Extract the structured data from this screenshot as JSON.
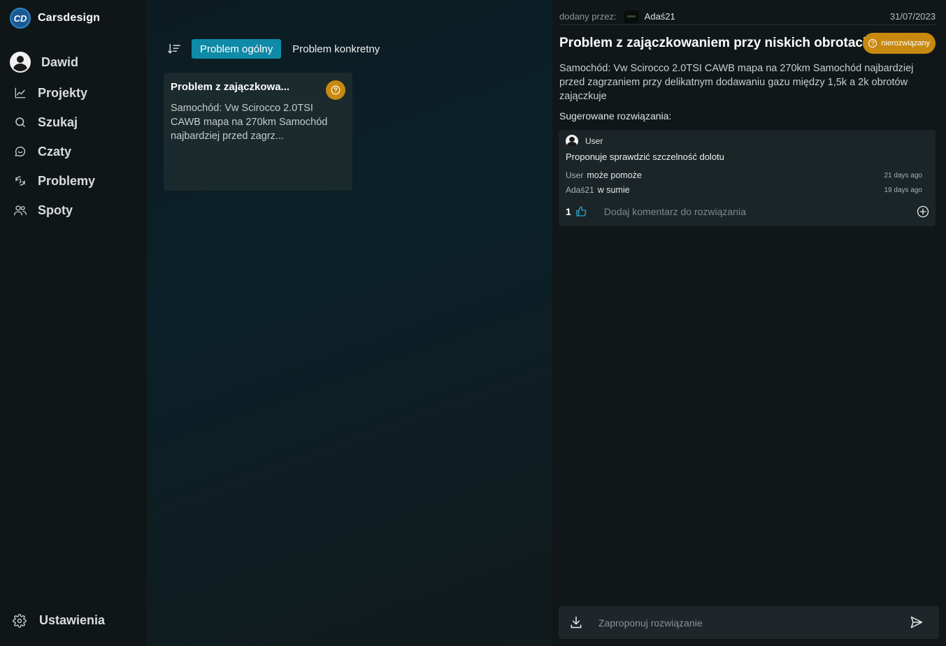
{
  "brand": {
    "logo_text": "CD",
    "name": "Carsdesign"
  },
  "sidebar": {
    "user_name": "Dawid",
    "items": [
      {
        "label": "Projekty",
        "icon": "chart-line-icon"
      },
      {
        "label": "Szukaj",
        "icon": "search-icon"
      },
      {
        "label": "Czaty",
        "icon": "chat-icon"
      },
      {
        "label": "Problemy",
        "icon": "problems-icon"
      },
      {
        "label": "Spoty",
        "icon": "users-icon"
      }
    ],
    "settings_label": "Ustawienia"
  },
  "filters": {
    "active": "Problem ogólny",
    "inactive": "Problem konkretny"
  },
  "problem_card": {
    "title": "Problem z zajączkowa...",
    "excerpt": "Samochód: Vw Scirocco 2.0TSI CAWB mapa na 270km Samochód najbardziej przed zagrz..."
  },
  "detail": {
    "added_by_label": "dodany przez:",
    "author": "Adaś21",
    "date": "31/07/2023",
    "title": "Problem z zajączkowaniem przy niskich obrotach",
    "status": "nierozwiązany",
    "description": "Samochód: Vw Scirocco 2.0TSI CAWB mapa na 270km Samochód najbardziej przed zagrzaniem przy delikatnym dodawaniu gazu między 1,5k a 2k obrotów zajączkuje",
    "suggested_label": "Sugerowane rozwiązania:",
    "solution": {
      "user": "User",
      "text": "Proponuje sprawdzić szczelność dolotu",
      "comments": [
        {
          "user": "User",
          "text": "może pomoże",
          "time": "21 days ago"
        },
        {
          "user": "Adaś21",
          "text": "w sumie",
          "time": "19 days ago"
        }
      ],
      "likes": "1",
      "add_comment_label": "Dodaj komentarz do rozwiązania"
    },
    "composer_placeholder": "Zaproponuj rozwiązanie"
  },
  "colors": {
    "accent": "#0f8aa7",
    "status_warning": "#c8890f"
  }
}
